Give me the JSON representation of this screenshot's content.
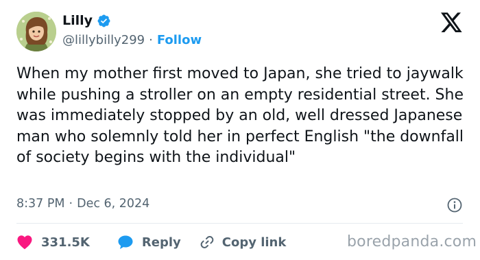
{
  "author": {
    "name": "Lilly",
    "handle": "@lillybilly299",
    "separator": "·",
    "follow_label": "Follow"
  },
  "tweet": {
    "text": "When my mother first moved to Japan, she tried to jaywalk while pushing a stroller on an empty residential street. She was immediately stopped by an old, well dressed Japanese man who solemnly told her in perfect English \"the downfall of society begins with the individual\"",
    "time": "8:37 PM",
    "separator": "·",
    "date": "Dec 6, 2024"
  },
  "actions": {
    "like_count": "331.5K",
    "reply_label": "Reply",
    "copy_label": "Copy link"
  },
  "watermark": "boredpanda.com",
  "icons": {
    "platform": "x-logo-icon",
    "verified": "verified-badge-icon",
    "info": "info-icon",
    "like": "heart-icon",
    "reply": "speech-bubble-icon",
    "copy": "link-icon"
  },
  "colors": {
    "accent": "#1d9bf0",
    "like": "#f91880",
    "text": "#0f1419",
    "muted": "#536471"
  }
}
